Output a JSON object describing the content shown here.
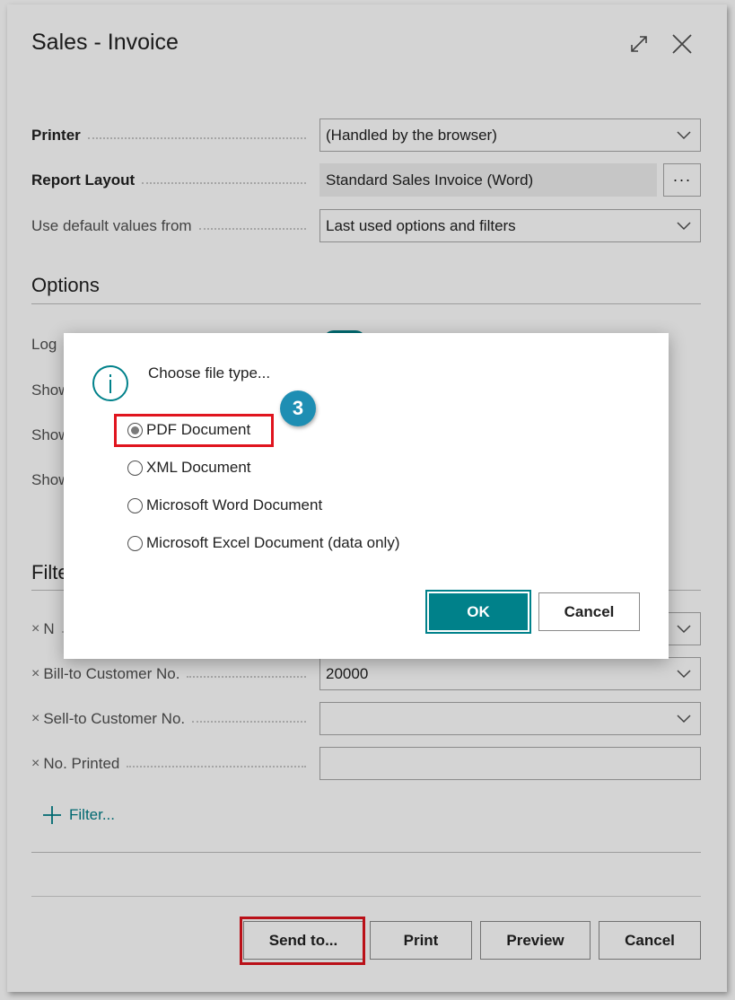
{
  "dialog": {
    "title": "Sales - Invoice",
    "fields": {
      "printer": {
        "label": "Printer",
        "value": "(Handled by the browser)"
      },
      "report_layout": {
        "label": "Report Layout",
        "value": "Standard Sales Invoice (Word)",
        "more": "···"
      },
      "defaults": {
        "label": "Use default values from",
        "value": "Last used options and filters"
      }
    },
    "options": {
      "header": "Options",
      "labels": [
        "Log",
        "Show",
        "Show",
        "Show"
      ]
    },
    "filters": {
      "header": "Filte",
      "rows": [
        {
          "label": "N",
          "value": ""
        },
        {
          "label": "Bill-to Customer No.",
          "value": "20000"
        },
        {
          "label": "Sell-to Customer No.",
          "value": ""
        },
        {
          "label": "No. Printed",
          "value": ""
        }
      ],
      "remove_glyph": "×",
      "add_filter": "Filter..."
    },
    "buttons": {
      "send_to": "Send to...",
      "print": "Print",
      "preview": "Preview",
      "cancel": "Cancel"
    }
  },
  "modal": {
    "message": "Choose file type...",
    "step_badge": "3",
    "options": [
      {
        "label": "PDF Document",
        "selected": true
      },
      {
        "label": "XML Document",
        "selected": false
      },
      {
        "label": "Microsoft Word Document",
        "selected": false
      },
      {
        "label": "Microsoft Excel Document (data only)",
        "selected": false
      }
    ],
    "ok": "OK",
    "cancel": "Cancel"
  },
  "colors": {
    "accent": "#00818a",
    "highlight": "#e0141e",
    "badge": "#1e8eb3"
  },
  "icons": [
    "expand-icon",
    "close-icon",
    "chevron-down-icon",
    "info-icon",
    "plus-icon"
  ]
}
